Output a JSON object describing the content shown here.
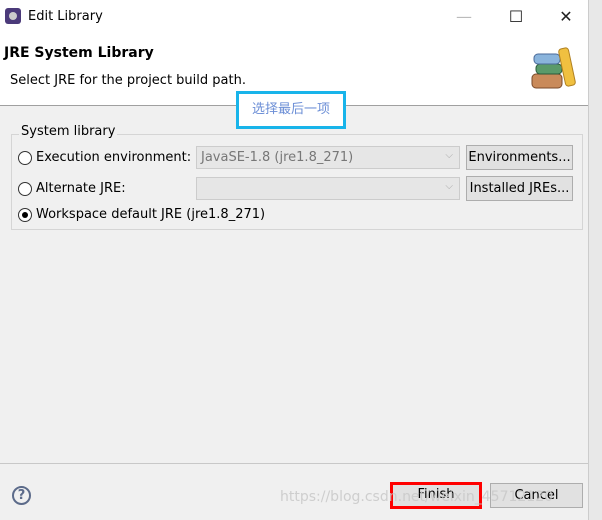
{
  "window": {
    "title": "Edit Library",
    "minimize_icon": "minimize-icon",
    "maximize_icon": "maximize-icon",
    "close_icon": "close-icon"
  },
  "header": {
    "title": "JRE System Library",
    "subtitle": "Select JRE for the project build path."
  },
  "annotation": {
    "text": "选择最后一项",
    "border_color": "#18b4ea"
  },
  "group": {
    "label": "System library",
    "options": [
      {
        "label": "Execution environment:",
        "selected": false,
        "combo_value": "JavaSE-1.8 (jre1.8_271)",
        "button": "Environments..."
      },
      {
        "label": "Alternate JRE:",
        "selected": false,
        "combo_value": "",
        "button": "Installed JREs..."
      },
      {
        "label": "Workspace default JRE (jre1.8_271)",
        "selected": true
      }
    ]
  },
  "footer": {
    "finish": "Finish",
    "cancel": "Cancel",
    "highlight_color": "#ff0000"
  },
  "watermark": "https://blog.csdn.net/weixin_45712120"
}
